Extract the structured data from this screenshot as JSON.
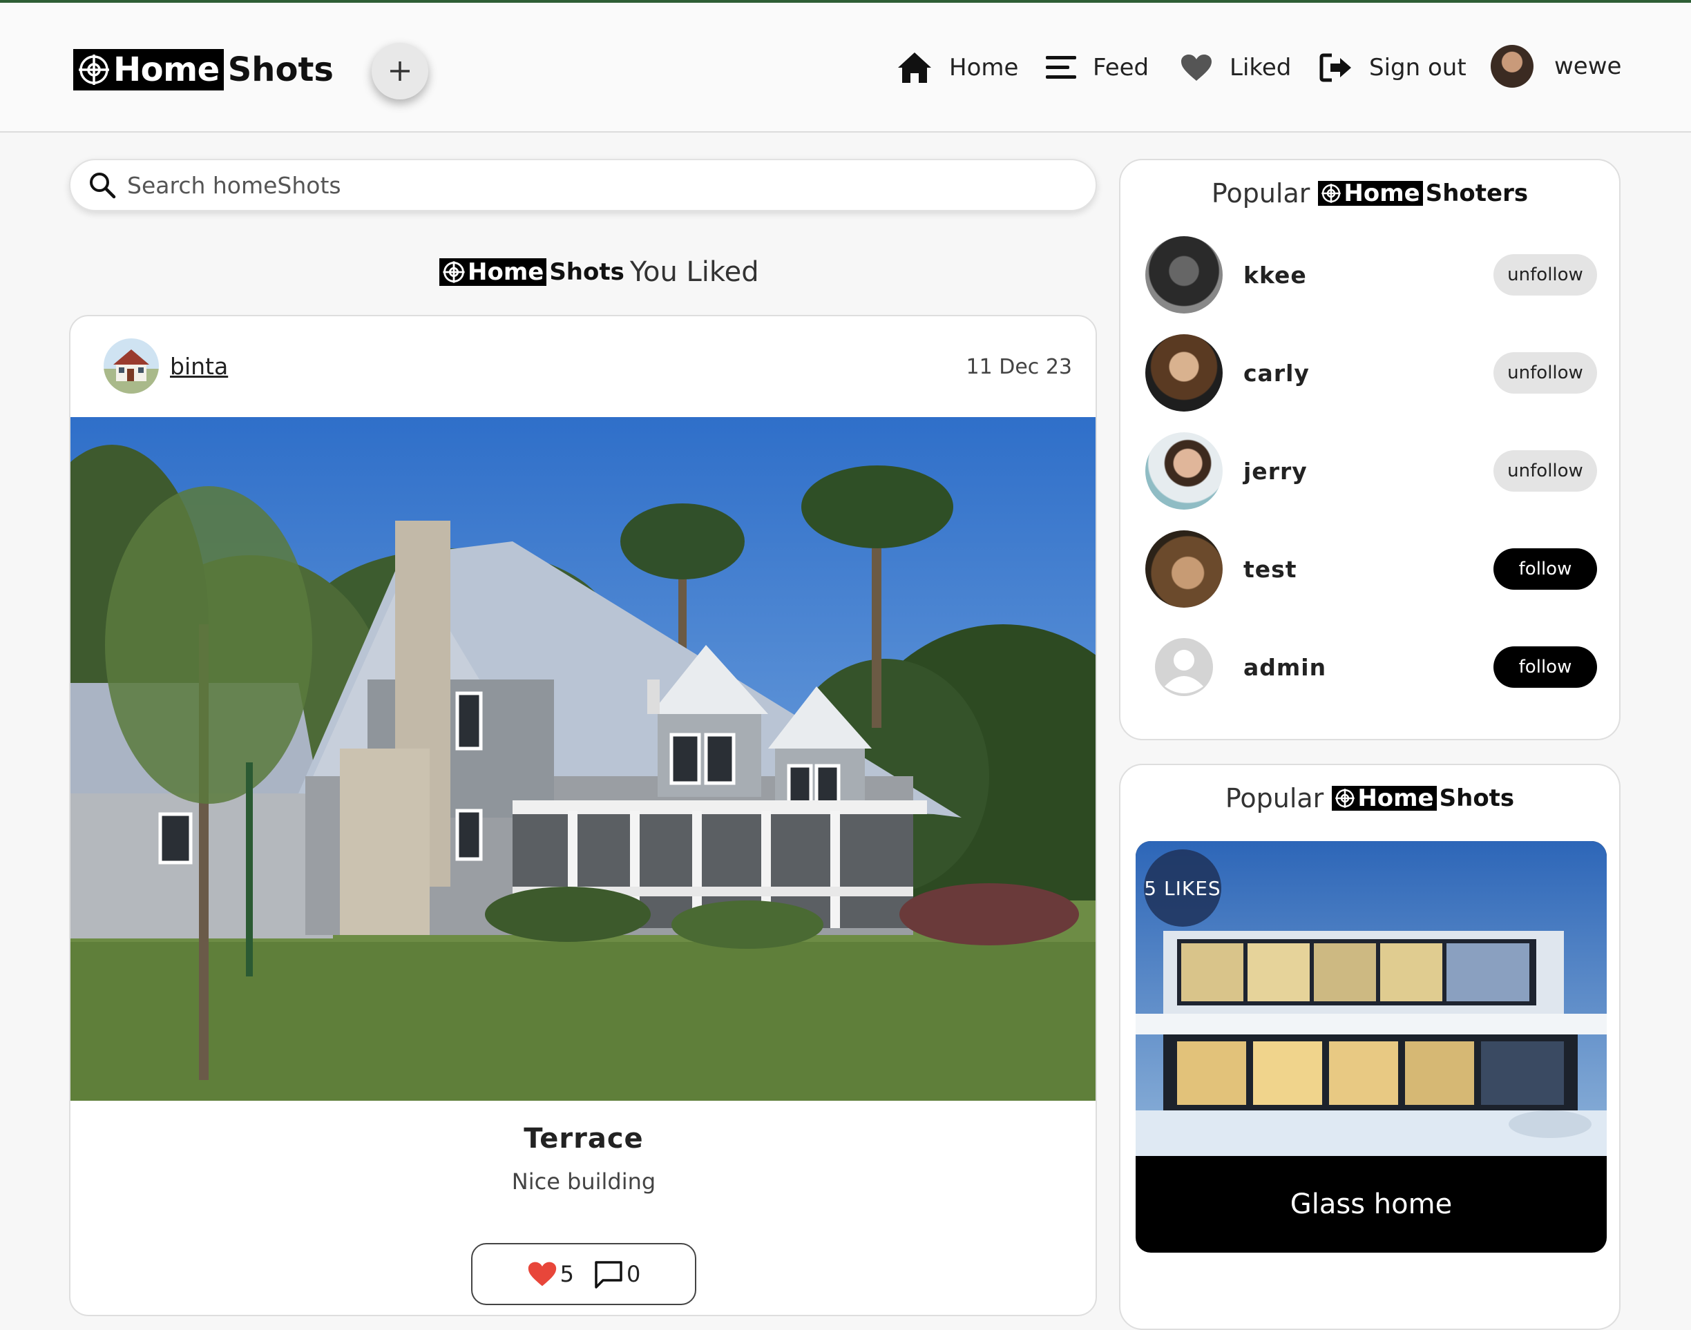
{
  "brand": {
    "home": "Home",
    "shots": "Shots"
  },
  "header": {
    "add_label": "+",
    "nav": {
      "home": "Home",
      "feed": "Feed",
      "liked": "Liked",
      "signout": "Sign out"
    },
    "username": "wewe"
  },
  "search": {
    "placeholder": "Search homeShots",
    "value": ""
  },
  "liked_section": {
    "title_suffix": "You Liked"
  },
  "post": {
    "username": "binta",
    "date": "11 Dec 23",
    "title": "Terrace",
    "description": "Nice building",
    "likes": "5",
    "comments": "0"
  },
  "popular_shooters": {
    "title_prefix": "Popular",
    "title_suffix": "Shoters",
    "users": [
      {
        "name": "kkee",
        "action": "unfollow"
      },
      {
        "name": "carly",
        "action": "unfollow"
      },
      {
        "name": "jerry",
        "action": "unfollow"
      },
      {
        "name": "test",
        "action": "follow"
      },
      {
        "name": "admin",
        "action": "follow"
      }
    ]
  },
  "popular_shots": {
    "title_prefix": "Popular",
    "title_suffix": "Shots",
    "items": [
      {
        "likes_label": "5 LIKES",
        "caption": "Glass home"
      }
    ]
  },
  "colors": {
    "accent_line": "#2e5e35",
    "like_heart": "#e8463a",
    "follow_bg": "#000000",
    "unfollow_bg": "#e4e4e4"
  }
}
